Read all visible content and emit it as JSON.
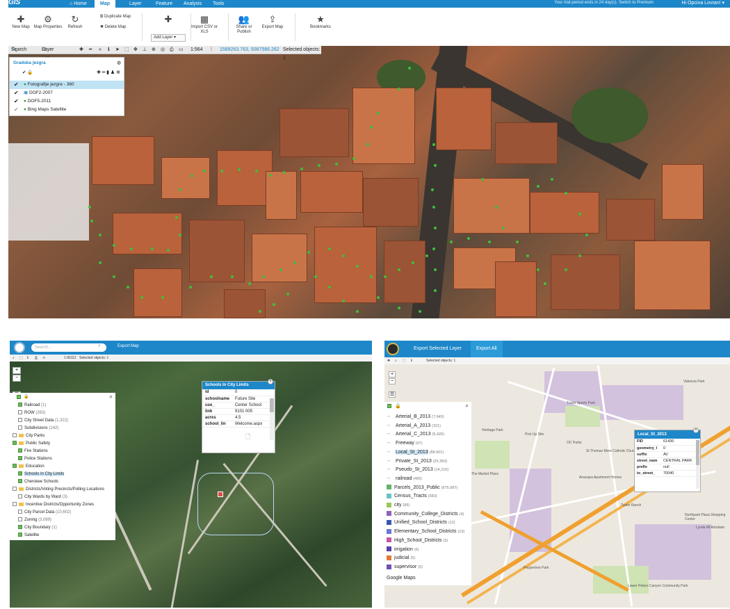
{
  "app": {
    "logo": "GIS",
    "menu": [
      "Home",
      "Map",
      "Layer",
      "Feature",
      "Analysis",
      "Tools"
    ],
    "active_menu": "Map",
    "notice": "Your trial period ends in 24 day(s). Switch to Premium",
    "user": "Hi Opcina Lovran! ▾"
  },
  "ribbon": {
    "new_map": "New Map",
    "map_properties": "Map Properties",
    "refresh": "Refresh",
    "duplicate_map": "Duplicate Map",
    "delete_map": "Delete Map",
    "add_layer": "Add Layer",
    "import_csv": "Import CSV or XLS",
    "share_publish": "Share or Publish",
    "export_map": "Export Map",
    "bookmarks": "Bookmarks"
  },
  "maptools": {
    "search": "Search",
    "layer_list": "Layer List",
    "scale": "1:564",
    "coords": "1589263.763, 5087586.262",
    "selected": "Selected objects: 1"
  },
  "layer_panel": {
    "title": "Gradska jezgra",
    "layers": [
      {
        "name": "Fotografije jezgre - 360",
        "selected": true
      },
      {
        "name": "DOF2-2007",
        "selected": false
      },
      {
        "name": "DOF5-2011",
        "selected": false
      },
      {
        "name": "Bing Maps Satellite",
        "selected": false
      }
    ]
  },
  "panel2": {
    "search_placeholder": "Search...",
    "export": "Export Map",
    "scale": "1:96112",
    "selected": "Selected objects: 1",
    "tree": [
      {
        "label": "Railroad",
        "count": "(1)",
        "type": "layer",
        "checked": true
      },
      {
        "label": "ROW",
        "count": "(263)",
        "type": "layer",
        "checked": false
      },
      {
        "label": "City Street Data",
        "count": "(1,322)",
        "type": "layer",
        "checked": false
      },
      {
        "label": "Subdivisions",
        "count": "(142)",
        "type": "layer",
        "checked": false
      },
      {
        "label": "City Parks",
        "count": "",
        "type": "folder",
        "checked": false
      },
      {
        "label": "Public Safety",
        "count": "",
        "type": "folder",
        "checked": true
      },
      {
        "label": "Fire Stations",
        "count": "",
        "type": "layer",
        "checked": true
      },
      {
        "label": "Police Stations",
        "count": "",
        "type": "layer",
        "checked": true
      },
      {
        "label": "Education",
        "count": "",
        "type": "folder",
        "checked": true
      },
      {
        "label": "Schools In City Limits",
        "count": "",
        "type": "layer",
        "checked": true,
        "selected": true
      },
      {
        "label": "Cherokee Schools",
        "count": "",
        "type": "layer",
        "checked": true
      },
      {
        "label": "Districts/Voting Precincts/Polling Locations",
        "count": "",
        "type": "folder",
        "checked": false
      },
      {
        "label": "City Wards by Ward",
        "count": "(3)",
        "type": "layer",
        "checked": false
      },
      {
        "label": "Incentive Districts/Opportunity Zones",
        "count": "",
        "type": "folder",
        "checked": false
      },
      {
        "label": "City Parcel Data",
        "count": "(10,602)",
        "type": "layer",
        "checked": false
      },
      {
        "label": "Zoning",
        "count": "(3,089)",
        "type": "layer",
        "checked": false
      },
      {
        "label": "City Boundary",
        "count": "(1)",
        "type": "layer",
        "checked": true
      },
      {
        "label": "Satellite",
        "count": "",
        "type": "layer",
        "checked": true
      }
    ],
    "popup": {
      "title": "Schools In City Limits",
      "rows": [
        {
          "k": "id",
          "v": "0"
        },
        {
          "k": "schoolname",
          "v": "Future Site"
        },
        {
          "k": "use_",
          "v": "Center School"
        },
        {
          "k": "link",
          "v": "9101 005"
        },
        {
          "k": "acres",
          "v": "4.5"
        },
        {
          "k": "school_lin",
          "v": "Welcome.aspx"
        }
      ]
    }
  },
  "panel3": {
    "export_layer": "Export Selected Layer",
    "export_all": "Export All",
    "selected": "Selected objects: 1",
    "layers": [
      {
        "name": "Arterial_B_2013",
        "count": "(7,645)",
        "kind": "line",
        "color": "#98a9c9"
      },
      {
        "name": "Arterial_A_2013",
        "count": "(321)",
        "kind": "line",
        "color": "#98a9c9"
      },
      {
        "name": "Arterial_C_2013",
        "count": "(5,426)",
        "kind": "line",
        "color": "#98a9c9"
      },
      {
        "name": "Freeway",
        "count": "(97)",
        "kind": "line",
        "color": "#98a9c9"
      },
      {
        "name": "Local_St_2013",
        "count": "(68,901)",
        "kind": "line",
        "color": "#98a9c9",
        "selected": true
      },
      {
        "name": "Private_St_2013",
        "count": "(25,350)",
        "kind": "line",
        "color": "#98a9c9"
      },
      {
        "name": "Pseudo_St_2013",
        "count": "(14,216)",
        "kind": "line",
        "color": "#98a9c9"
      },
      {
        "name": "railroad",
        "count": "(465)",
        "kind": "line",
        "color": "#98a9c9"
      },
      {
        "name": "Parcels_2013_Public",
        "count": "(675,987)",
        "kind": "fill",
        "color": "#62b56a"
      },
      {
        "name": "Census_Tracts",
        "count": "(583)",
        "kind": "fill",
        "color": "#6ac4c4"
      },
      {
        "name": "city",
        "count": "(96)",
        "kind": "fill",
        "color": "#9bc85a"
      },
      {
        "name": "Community_College_Districts",
        "count": "(4)",
        "kind": "fill",
        "color": "#8a64b5"
      },
      {
        "name": "Unified_School_Districts",
        "count": "(12)",
        "kind": "fill",
        "color": "#3a57b0"
      },
      {
        "name": "Elementary_School_Districts",
        "count": "(13)",
        "kind": "fill",
        "color": "#6b78d4"
      },
      {
        "name": "High_School_Districts",
        "count": "(3)",
        "kind": "fill",
        "color": "#c05aa8"
      },
      {
        "name": "irrigation",
        "count": "(6)",
        "kind": "fill",
        "color": "#5a3ea8"
      },
      {
        "name": "judicial",
        "count": "(5)",
        "kind": "fill",
        "color": "#e07a3a"
      },
      {
        "name": "supervisor",
        "count": "(5)",
        "kind": "fill",
        "color": "#6f51b0"
      }
    ],
    "basemap": "Google Maps",
    "popup": {
      "title": "Local_St_2013",
      "rows": [
        {
          "k": "FID",
          "v": "61436"
        },
        {
          "k": "geometry_l",
          "v": "0"
        },
        {
          "k": "suffix",
          "v": "AV"
        },
        {
          "k": "street_nam",
          "v": "CENTRAL PARK"
        },
        {
          "k": "prefix",
          "v": "null"
        },
        {
          "k": "to_street_",
          "v": "70040"
        }
      ]
    },
    "map_labels": [
      "Tustin Sports Park",
      "Valencia Park",
      "Pick Up Site",
      "OC Parks",
      "St Thomas More Catholic Church",
      "Northpark Plaza Shopping Center",
      "Lower Peters Canyon Community Park",
      "Peppertree Park",
      "Heritage Park",
      "The Market Place",
      "Anacapa Apartment Homes",
      "Tustin Ranch",
      "Lynda Ml Arbolado"
    ]
  },
  "colors": {
    "accent": "#1d87c9",
    "map_dot": "#3fbf3a",
    "highway": "#f0a030"
  }
}
